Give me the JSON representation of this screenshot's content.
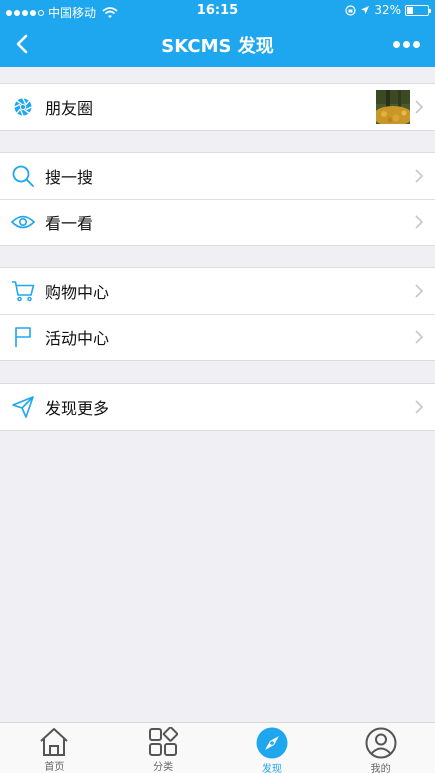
{
  "status_bar": {
    "carrier": "中国移动",
    "time": "16:15",
    "battery": "32%",
    "battery_level": 0.32
  },
  "nav": {
    "title": "SKCMS 发现",
    "back_icon": "chevron-left-icon",
    "more_icon": "more-dots-icon"
  },
  "groups": [
    {
      "items": [
        {
          "label": "朋友圈",
          "icon": "moments-aperture-icon",
          "has_thumbnail": true
        }
      ]
    },
    {
      "items": [
        {
          "label": "搜一搜",
          "icon": "search-icon"
        },
        {
          "label": "看一看",
          "icon": "eye-icon"
        }
      ]
    },
    {
      "items": [
        {
          "label": "购物中心",
          "icon": "cart-icon"
        },
        {
          "label": "活动中心",
          "icon": "flag-icon"
        }
      ]
    },
    {
      "items": [
        {
          "label": "发现更多",
          "icon": "paper-plane-icon"
        }
      ]
    }
  ],
  "tabbar": [
    {
      "label": "首页",
      "icon": "home-icon",
      "active": false
    },
    {
      "label": "分类",
      "icon": "category-grid-icon",
      "active": false
    },
    {
      "label": "发现",
      "icon": "compass-icon",
      "active": true
    },
    {
      "label": "我的",
      "icon": "user-icon",
      "active": false
    }
  ],
  "colors": {
    "accent": "#1ea6ee",
    "background": "#efeff4"
  }
}
